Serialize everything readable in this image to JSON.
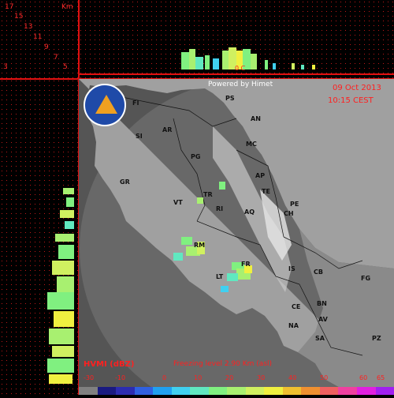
{
  "header": {
    "date": "09 Oct 2013",
    "time": "10:15 CEST",
    "powered_by": "Powered by Himet",
    "freezing_level_line": "0 C"
  },
  "height_axis": {
    "unit": "Km",
    "labels": [
      "17",
      "15",
      "13",
      "11",
      "9",
      "7",
      "5",
      "3"
    ]
  },
  "legend": {
    "product": "HVMI (dBZ)",
    "freezing_level": "Freezing level 2.90 Km (asl)",
    "ticks": [
      "-30",
      "-10",
      "0",
      "10",
      "20",
      "30",
      "40",
      "50",
      "60",
      "65"
    ],
    "colors": [
      "#808080",
      "#1a1a80",
      "#2c2cb0",
      "#3060e0",
      "#20a0f0",
      "#40d0f0",
      "#60e8c0",
      "#80f080",
      "#a8f070",
      "#d0f060",
      "#f0f040",
      "#f0c030",
      "#f09030",
      "#f06060",
      "#f040a0",
      "#e020e0",
      "#a020f0"
    ]
  },
  "logo": {
    "text": "Protezione Civile"
  },
  "cities": [
    {
      "name": "PS"
    },
    {
      "name": "FI"
    },
    {
      "name": "AN"
    },
    {
      "name": "SI"
    },
    {
      "name": "AR"
    },
    {
      "name": "MC"
    },
    {
      "name": "PG"
    },
    {
      "name": "AP"
    },
    {
      "name": "GR"
    },
    {
      "name": "TE"
    },
    {
      "name": "TR"
    },
    {
      "name": "PE"
    },
    {
      "name": "VT"
    },
    {
      "name": "RI"
    },
    {
      "name": "AQ"
    },
    {
      "name": "CH"
    },
    {
      "name": "RM"
    },
    {
      "name": "FR"
    },
    {
      "name": "IS"
    },
    {
      "name": "CB"
    },
    {
      "name": "FG"
    },
    {
      "name": "LT"
    },
    {
      "name": "CE"
    },
    {
      "name": "BN"
    },
    {
      "name": "NA"
    },
    {
      "name": "AV"
    },
    {
      "name": "SA"
    },
    {
      "name": "PZ"
    }
  ],
  "colors": {
    "grid_dot": "#c01818",
    "separator": "#e01010",
    "sea": "#555555",
    "land": "#a8a8a8",
    "radar_range": "#6a6a6a"
  }
}
